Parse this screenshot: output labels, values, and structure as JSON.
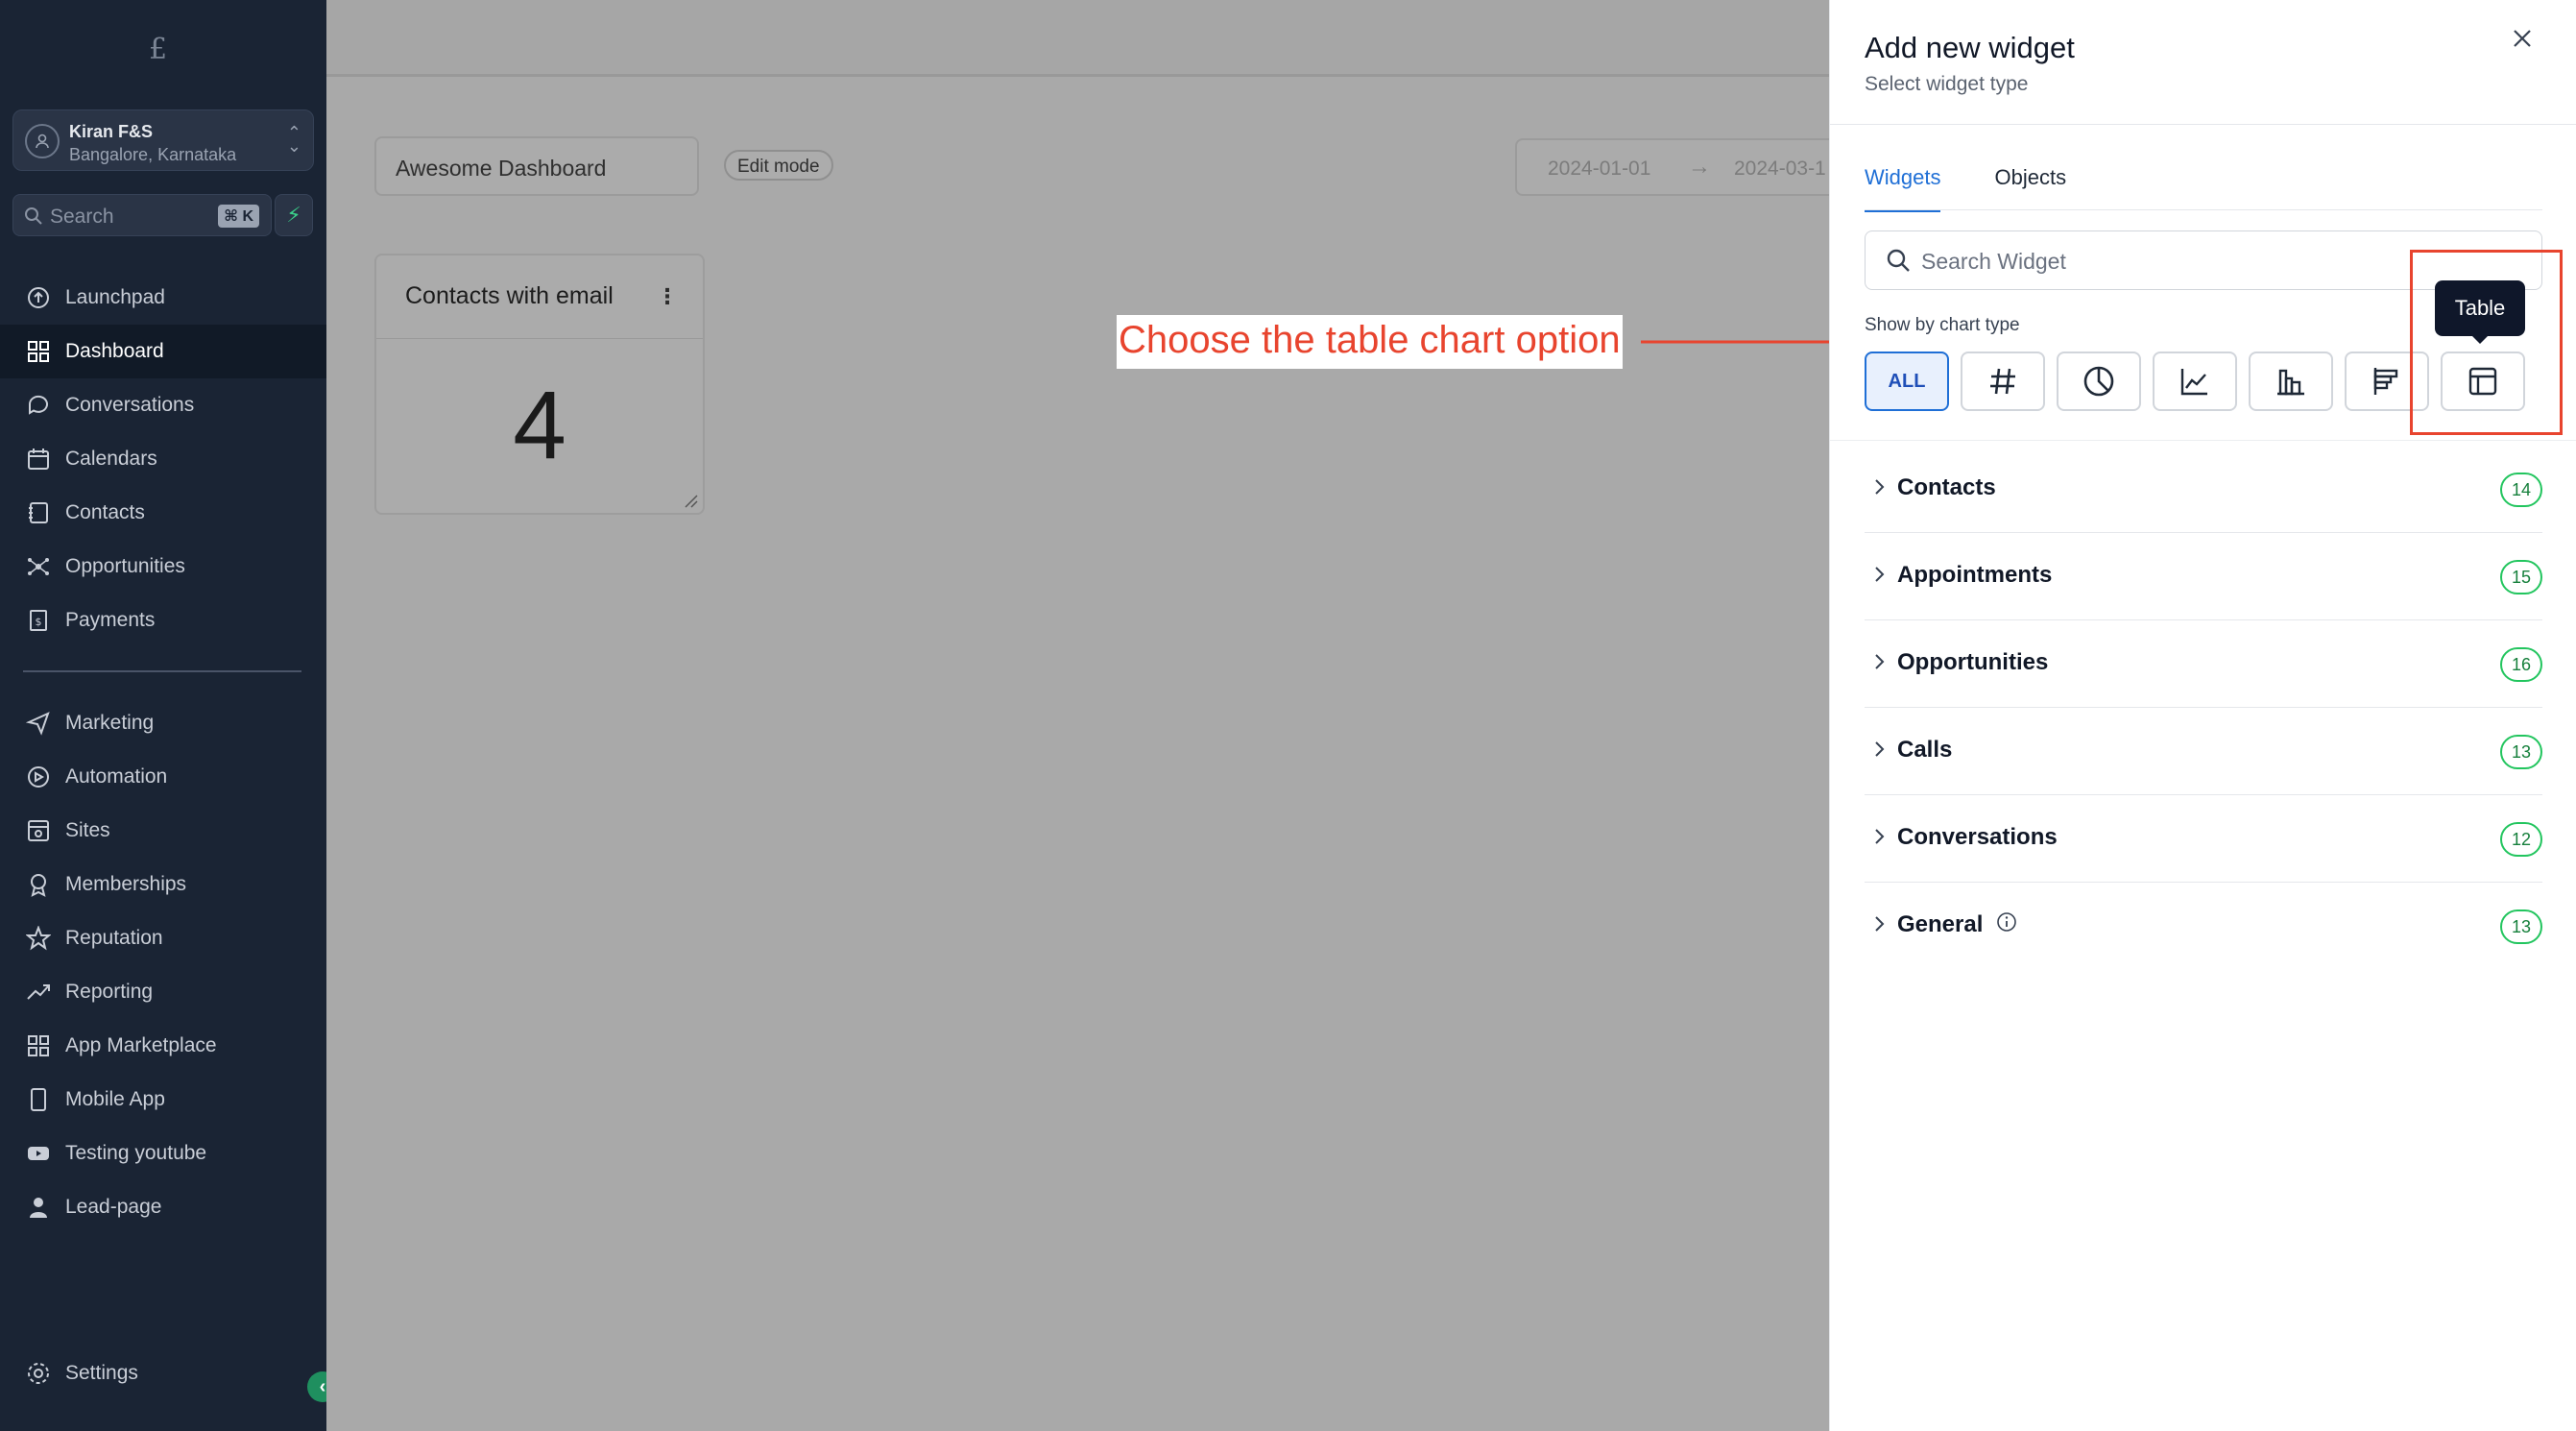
{
  "sidebar": {
    "logo": "£",
    "account": {
      "name": "Kiran F&S",
      "location": "Bangalore, Karnataka"
    },
    "search": {
      "placeholder": "Search",
      "shortcut": "⌘ K"
    },
    "items_top": [
      {
        "label": "Launchpad",
        "icon": "launchpad-icon"
      },
      {
        "label": "Dashboard",
        "icon": "dashboard-icon",
        "active": true
      },
      {
        "label": "Conversations",
        "icon": "chat-bubble-icon"
      },
      {
        "label": "Calendars",
        "icon": "calendar-icon"
      },
      {
        "label": "Contacts",
        "icon": "contacts-icon"
      },
      {
        "label": "Opportunities",
        "icon": "opportunities-icon"
      },
      {
        "label": "Payments",
        "icon": "payments-icon"
      }
    ],
    "items_bottom": [
      {
        "label": "Marketing",
        "icon": "send-icon"
      },
      {
        "label": "Automation",
        "icon": "automation-icon"
      },
      {
        "label": "Sites",
        "icon": "sites-icon"
      },
      {
        "label": "Memberships",
        "icon": "award-icon"
      },
      {
        "label": "Reputation",
        "icon": "star-icon"
      },
      {
        "label": "Reporting",
        "icon": "trending-up-icon"
      },
      {
        "label": "App Marketplace",
        "icon": "grid-icon"
      },
      {
        "label": "Mobile App",
        "icon": "mobile-icon"
      },
      {
        "label": "Testing youtube",
        "icon": "youtube-icon"
      },
      {
        "label": "Lead-page",
        "icon": "user-lock-icon"
      }
    ],
    "settings_label": "Settings"
  },
  "main": {
    "dashboard_name": "Awesome Dashboard",
    "edit_mode_label": "Edit mode",
    "date_start": "2024-01-01",
    "date_end": "2024-03-1",
    "card": {
      "title": "Contacts with email",
      "value": "4"
    },
    "annotation": "Choose the table chart option"
  },
  "panel": {
    "title": "Add new widget",
    "subtitle": "Select widget type",
    "tabs": [
      "Widgets",
      "Objects"
    ],
    "search_placeholder": "Search Widget",
    "chart_type_label": "Show by chart type",
    "chart_types": [
      {
        "label": "ALL",
        "icon": ""
      },
      {
        "label": "",
        "icon": "hash-icon"
      },
      {
        "label": "",
        "icon": "pie-chart-icon"
      },
      {
        "label": "",
        "icon": "line-chart-icon"
      },
      {
        "label": "",
        "icon": "bar-chart-icon"
      },
      {
        "label": "",
        "icon": "horizontal-bar-icon"
      },
      {
        "label": "",
        "icon": "table-icon"
      }
    ],
    "tooltip": "Table",
    "categories": [
      {
        "name": "Contacts",
        "count": "14"
      },
      {
        "name": "Appointments",
        "count": "15"
      },
      {
        "name": "Opportunities",
        "count": "16"
      },
      {
        "name": "Calls",
        "count": "13"
      },
      {
        "name": "Conversations",
        "count": "12"
      },
      {
        "name": "General",
        "count": "13",
        "info": true
      }
    ]
  },
  "colors": {
    "sidebar_bg": "#1a2434",
    "accent": "#1f6fd6",
    "annotation": "#e8442e",
    "badge_green": "#22c55e"
  }
}
